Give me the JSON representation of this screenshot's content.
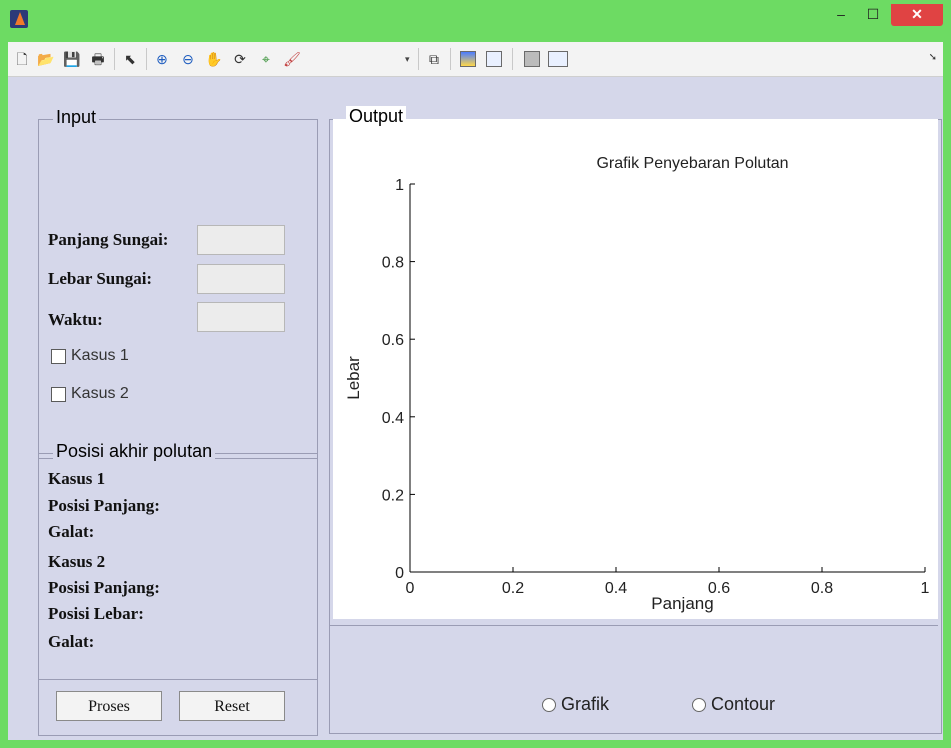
{
  "window": {
    "close_symbol": "✕",
    "min_symbol": "–",
    "max_symbol": "☐"
  },
  "toolbar": {
    "icons": [
      "new-file",
      "open-folder",
      "save",
      "print",
      "pointer",
      "zoom-in",
      "zoom-out",
      "pan-hand",
      "rotate-3d",
      "data-cursor",
      "brush",
      "link-plot",
      "colorbar",
      "legend",
      "hide-plot-tools",
      "show-plot-tools"
    ]
  },
  "input_panel": {
    "title": "Input",
    "panjang_label": "Panjang Sungai:",
    "lebar_label": "Lebar Sungai:",
    "waktu_label": "Waktu:",
    "kasus1_label": "Kasus 1",
    "kasus2_label": "Kasus 2"
  },
  "posisi_panel": {
    "title": "Posisi akhir polutan",
    "lines": [
      "Kasus 1",
      "Posisi Panjang:",
      "Galat:",
      "Kasus 2",
      "Posisi Panjang:",
      "Posisi Lebar:",
      "Galat:"
    ]
  },
  "buttons": {
    "proses": "Proses",
    "reset": "Reset"
  },
  "output_panel": {
    "title": "Output"
  },
  "radios": {
    "grafik": "Grafik",
    "contour": "Contour"
  },
  "chart_data": {
    "type": "scatter",
    "title": "Grafik Penyebaran Polutan",
    "xlabel": "Panjang",
    "ylabel": "Lebar",
    "xlim": [
      0,
      1
    ],
    "ylim": [
      0,
      1
    ],
    "xticks": [
      "0",
      "0.2",
      "0.4",
      "0.6",
      "0.8",
      "1"
    ],
    "yticks": [
      "0",
      "0.2",
      "0.4",
      "0.6",
      "0.8",
      "1"
    ],
    "series": [],
    "grid": false
  },
  "colors": {
    "background": "#d5d7ea",
    "titlebar": "#6ddb63",
    "close": "#e04343"
  }
}
